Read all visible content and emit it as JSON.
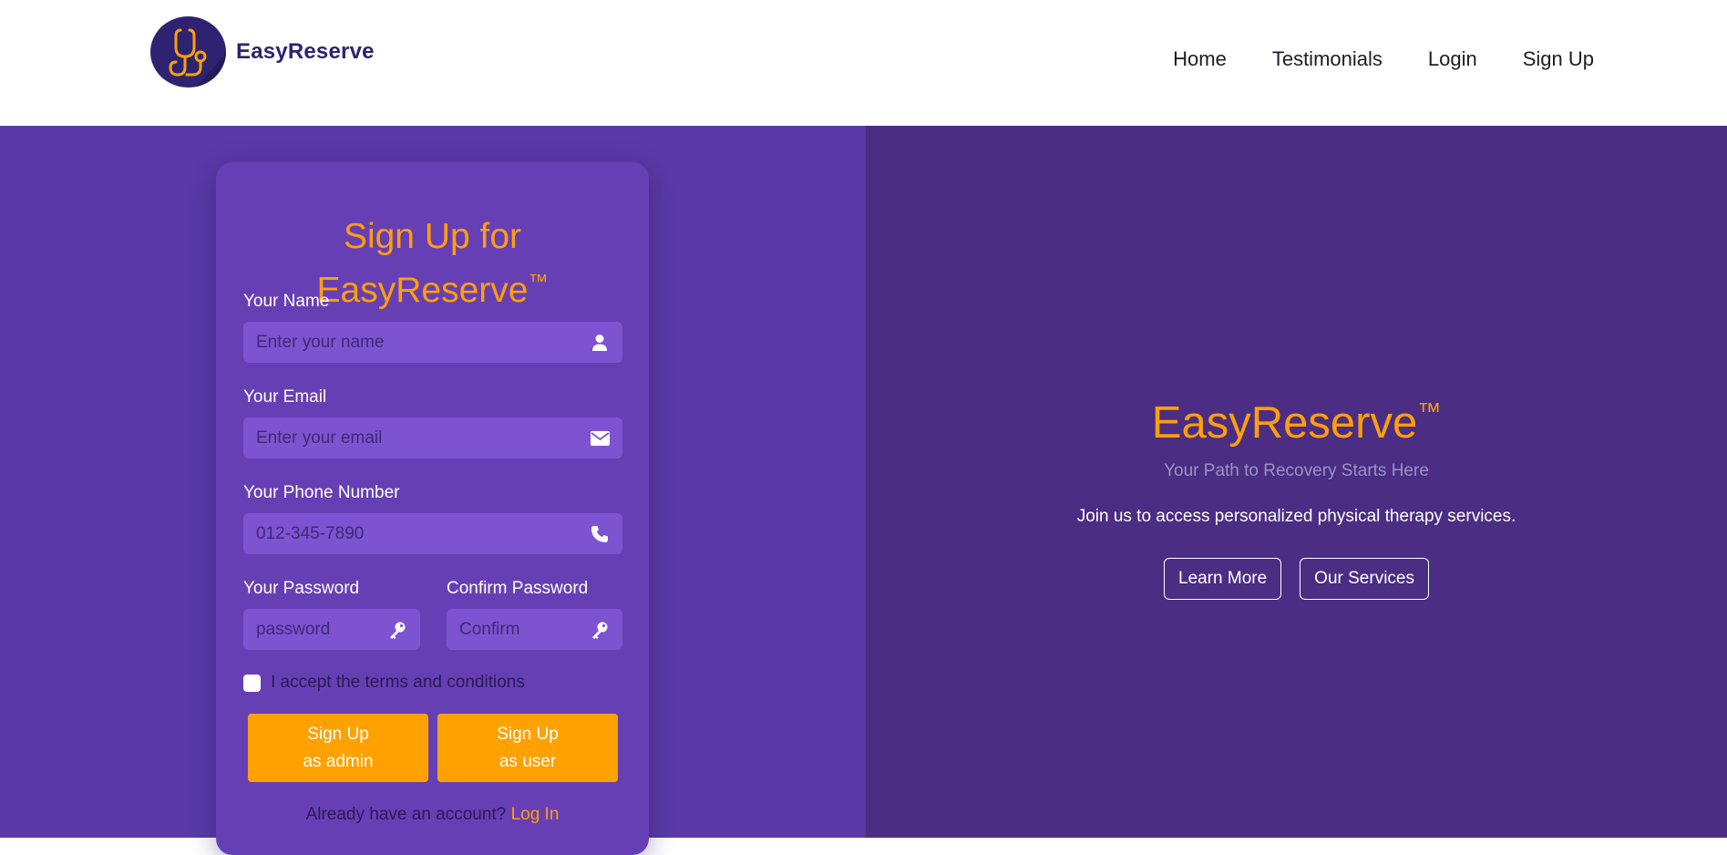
{
  "brand": {
    "name": "EasyReserve",
    "logo_icon": "stethoscope-icon"
  },
  "nav": {
    "links": [
      {
        "label": "Home"
      },
      {
        "label": "Testimonials"
      },
      {
        "label": "Login"
      },
      {
        "label": "Sign Up"
      }
    ]
  },
  "signup_form": {
    "title_line1": "Sign Up for",
    "title_line2": "EasyReserve",
    "title_tm": "™",
    "name": {
      "label": "Your Name",
      "placeholder": "Enter your name",
      "icon": "user-icon"
    },
    "email": {
      "label": "Your Email",
      "placeholder": "Enter your email",
      "icon": "envelope-icon"
    },
    "phone": {
      "label": "Your Phone Number",
      "placeholder": "012-345-7890",
      "icon": "phone-icon"
    },
    "password": {
      "label": "Your Password",
      "placeholder": "password",
      "icon": "key-icon"
    },
    "confirm": {
      "label": "Confirm Password",
      "placeholder": "Confirm",
      "icon": "key-icon"
    },
    "terms_text": "I accept the terms and conditions",
    "admin_button": {
      "line1": "Sign Up",
      "line2": "as admin"
    },
    "user_button": {
      "line1": "Sign Up",
      "line2": "as user"
    },
    "login_prompt": "Already have an account?",
    "login_link": "Log In"
  },
  "hero": {
    "title": "EasyReserve",
    "title_tm": "™",
    "subtitle": "Your Path to Recovery Starts Here",
    "description": "Join us to access personalized physical therapy services.",
    "buttons": [
      {
        "label": "Learn More"
      },
      {
        "label": "Our Services"
      }
    ]
  },
  "colors": {
    "accent": "#ff9f0a",
    "left_panel_bg": "#593aa7",
    "card_bg": "#673fb5",
    "input_bg": "#7d53d2",
    "right_panel_bg": "#4b2d84",
    "brand_dark": "#2e2370"
  }
}
